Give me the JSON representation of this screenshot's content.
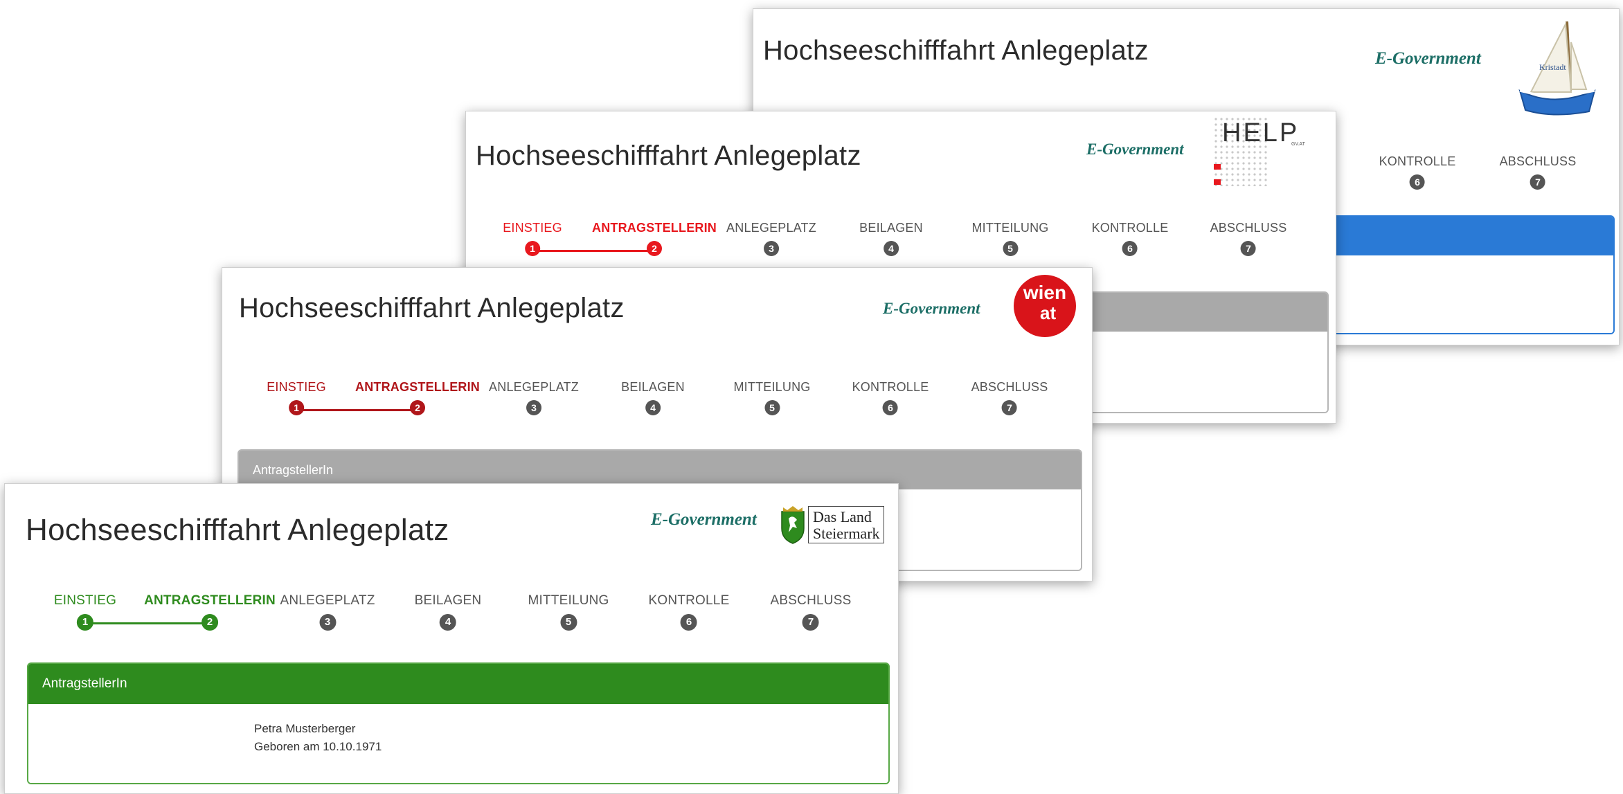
{
  "title": "Hochseeschifffahrt Anlegeplatz",
  "egov_label": "E-Government",
  "steps": [
    "EINSTIEG",
    "ANTRAGSTELLERIN",
    "ANLEGEPLATZ",
    "BEILAGEN",
    "MITTEILUNG",
    "KONTROLLE",
    "ABSCHLUSS"
  ],
  "step_numbers": [
    "1",
    "2",
    "3",
    "4",
    "5",
    "6",
    "7"
  ],
  "panel_title": "AntragstellerIn",
  "applicant": {
    "name": "Petra Musterberger",
    "birth": "Geboren am 10.10.1971"
  },
  "logos": {
    "help_text": "HELP",
    "help_sub": "GV.AT",
    "wien_line1": "wien",
    "wien_line2": "at",
    "steiermark_line1": "Das Land",
    "steiermark_line2": "Steiermark",
    "boat_sail_text": "Kristadt"
  },
  "themes": {
    "steiermark": "#2e8b1e",
    "wien": "#b0161a",
    "help": "#e8181e",
    "boat": "#2a7ad6",
    "neutral_header": "#a9a9a9"
  }
}
